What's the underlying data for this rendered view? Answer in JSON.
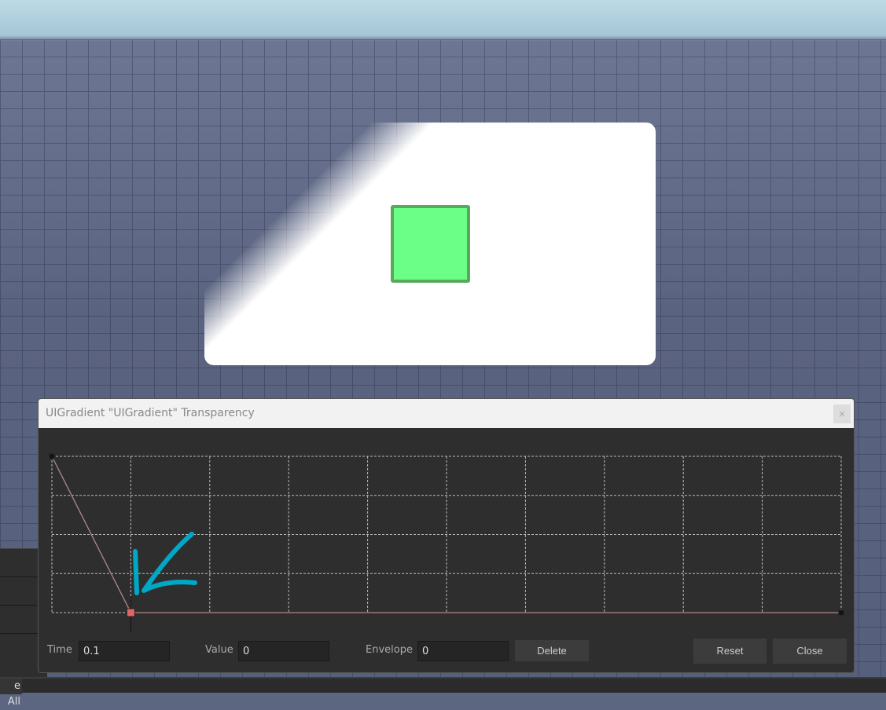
{
  "dialog": {
    "title": "UIGradient \"UIGradient\" Transparency",
    "close_glyph": "×"
  },
  "graph": {
    "keypoints": [
      {
        "time": 0,
        "value": 1
      },
      {
        "time": 0.1,
        "value": 0
      },
      {
        "time": 1,
        "value": 0
      }
    ],
    "selected_index": 1,
    "columns": 10,
    "rows": 4
  },
  "fields": {
    "time_label": "Time",
    "time_value": "0.1",
    "value_label": "Value",
    "value_value": "0",
    "envelope_label": "Envelope",
    "envelope_value": "0"
  },
  "buttons": {
    "delete": "Delete",
    "reset": "Reset",
    "close": "Close"
  },
  "bottombar": {
    "partial_label": "e All"
  },
  "colors": {
    "selected_point": "#e06666",
    "annotation": "#00a8c8"
  }
}
